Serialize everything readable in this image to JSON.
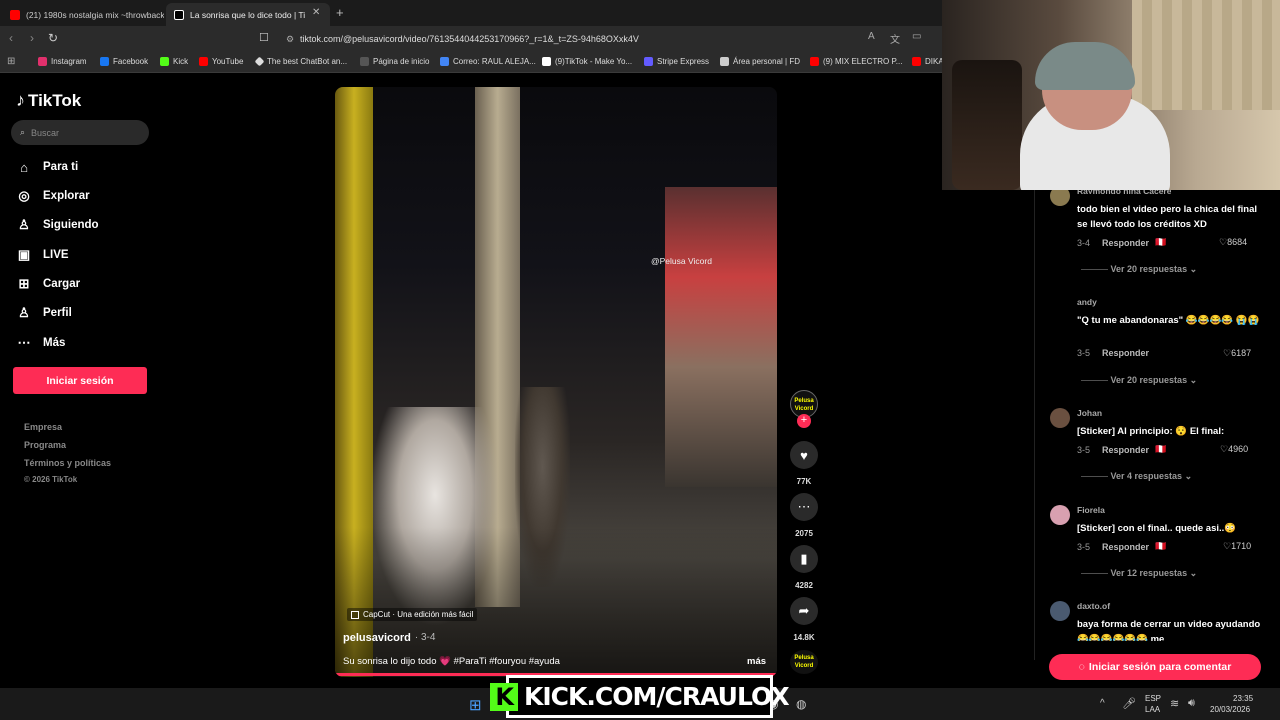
{
  "browser": {
    "tabs": [
      {
        "label": "(21) 1980s nostalgia mix ~throwback",
        "color": "#ff0000"
      },
      {
        "label": "La sonrisa que lo dice todo | TikT",
        "color": "#ffffff"
      }
    ],
    "url": "tiktok.com/@pelusavicord/video/7613544044253170966?_r=1&_t=ZS-94h68OXxk4V",
    "bookmarks": [
      {
        "label": "Instagram",
        "color": "#e1306c"
      },
      {
        "label": "Facebook",
        "color": "#1877f2"
      },
      {
        "label": "Kick",
        "color": "#53fc18"
      },
      {
        "label": "YouTube",
        "color": "#ff0000"
      },
      {
        "label": "The best ChatBot an...",
        "color": "#dddddd"
      },
      {
        "label": "Página de inicio",
        "color": "#888888"
      },
      {
        "label": "Correo: RAUL ALEJA...",
        "color": "#4285f4"
      },
      {
        "label": "(9)TikTok - Make Yo...",
        "color": "#ffffff"
      },
      {
        "label": "Stripe Express",
        "color": "#635bff"
      },
      {
        "label": "Área personal | FD",
        "color": "#cccccc"
      },
      {
        "label": "(9) MIX ELECTRO P...",
        "color": "#ff0000"
      },
      {
        "label": "DIKA",
        "color": "#ff0000"
      }
    ]
  },
  "sidebar": {
    "logo": "TikTok",
    "search_placeholder": "Buscar",
    "nav": [
      {
        "label": "Para ti",
        "icon": "home-icon"
      },
      {
        "label": "Explorar",
        "icon": "compass-icon"
      },
      {
        "label": "Siguiendo",
        "icon": "following-icon"
      },
      {
        "label": "LIVE",
        "icon": "live-icon"
      },
      {
        "label": "Cargar",
        "icon": "upload-icon"
      },
      {
        "label": "Perfil",
        "icon": "profile-icon"
      },
      {
        "label": "Más",
        "icon": "more-icon"
      }
    ],
    "login": "Iniciar sesión",
    "footer": [
      "Empresa",
      "Programa",
      "Términos y políticas",
      "© 2026 TikTok"
    ]
  },
  "video": {
    "watermark": "@Pelusa Vicord",
    "capcut": "CapCut · Una edición más fácil",
    "author": "pelusavicord",
    "date": "· 3-4",
    "caption": "Su sonrisa lo dijo todo 💗 #ParaTi #fouryou #ayuda",
    "more": "más",
    "likes": "77K",
    "comments": "2075",
    "saves": "4282",
    "shares": "14.8K",
    "avatar_text": "Pelusa Vicord"
  },
  "comments": [
    {
      "user": "Raymondo nina Cacere",
      "text": "todo bien el video pero la chica del final se llevó todo los créditos XD",
      "date": "3-4",
      "likes": "8684",
      "replies": "Ver 20 respuestas",
      "color": "#8a7a50"
    },
    {
      "user": "andy",
      "text": "\"Q tu me abandonaras\" 😂😂😂😂 😭😭",
      "date": "3-5",
      "likes": "6187",
      "replies": "Ver 20 respuestas",
      "color": "#000000"
    },
    {
      "user": "Johan",
      "text": "[Sticker] Al principio: 😯 El final:",
      "date": "3-5",
      "likes": "4960",
      "replies": "Ver 4 respuestas",
      "color": "#6a5040"
    },
    {
      "user": "Fiorela",
      "text": "[Sticker] con el final.. quede asi..😳",
      "date": "3-5",
      "likes": "1710",
      "replies": "Ver 12 respuestas",
      "color": "#d8a0b0"
    },
    {
      "user": "daxto.of",
      "text": "baya forma de cerrar un video ayudando 😂😂😂😂😂😂 me",
      "color": "#4a5a70"
    }
  ],
  "reply_label": "Responder",
  "comment_login": "Iniciar sesión para comentar",
  "stream_banner": "KICK.COM/CRAULOX",
  "taskbar": {
    "lang": "ESP",
    "lang2": "LAA",
    "time": "23:35",
    "date": "20/03/2026"
  }
}
